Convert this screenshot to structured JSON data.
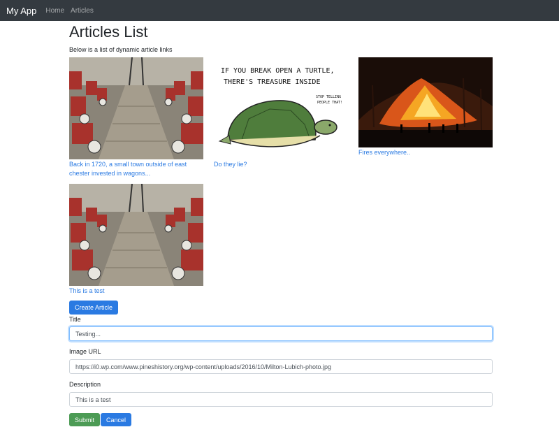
{
  "nav": {
    "brand": "My App",
    "links": [
      {
        "label": "Home"
      },
      {
        "label": "Articles"
      }
    ]
  },
  "page": {
    "title": "Articles List",
    "subtitle": "Below is a list of dynamic article links"
  },
  "articles": [
    {
      "title": "Back in 1720, a small town outside of east chester invested in wagons..."
    },
    {
      "title": "Do they lie?",
      "image_text": [
        "IF YOU BREAK OPEN A TURTLE,",
        "THERE'S TREASURE INSIDE"
      ],
      "speech": [
        "STOP TELLING",
        "PEOPLE THAT!"
      ]
    },
    {
      "title": "Fires everywhere.."
    },
    {
      "title": "This is a test"
    }
  ],
  "form": {
    "create_label": "Create Article",
    "title_label": "Title",
    "title_value": "Testing...",
    "image_url_label": "Image URL",
    "image_url_value": "https://i0.wp.com/www.pineshistory.org/wp-content/uploads/2016/10/Milton-Lubich-photo.jpg",
    "description_label": "Description",
    "description_value": "This is a test",
    "submit_label": "Submit",
    "cancel_label": "Cancel"
  },
  "colors": {
    "navbar": "#343a40",
    "link": "#2a7ae2",
    "primary": "#2a7ae2",
    "success": "#4c9b55"
  }
}
